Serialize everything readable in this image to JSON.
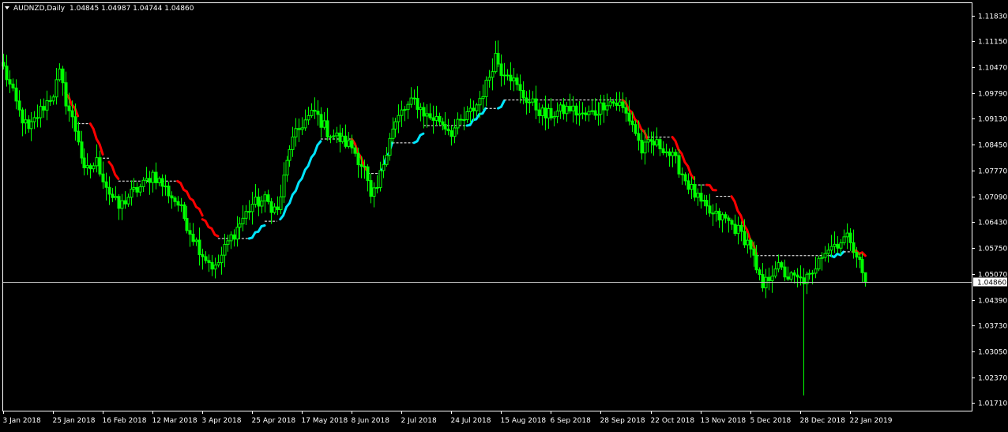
{
  "header": {
    "symbol_timeframe": "AUDNZD,Daily",
    "ohlc": "1.04845 1.04987 1.04744 1.04860"
  },
  "colors": {
    "background": "#000000",
    "frame": "#ffffff",
    "candle": "#00ff00",
    "trail_down": "#ff0000",
    "trail_up": "#00e5ff",
    "stop_line": "#ffffff",
    "current_price_line": "#c0c0c0"
  },
  "icons": {
    "menu": "triangle-down-icon"
  },
  "chart_data": {
    "type": "candlestick",
    "symbol": "AUDNZD",
    "timeframe": "Daily",
    "last_ohlc": {
      "open": 1.04845,
      "high": 1.04987,
      "low": 1.04744,
      "close": 1.0486
    },
    "current_price": 1.0486,
    "current_price_label": "1.04860",
    "ylim": [
      1.015,
      1.1215
    ],
    "y_ticks": [
      "1.11830",
      "1.11150",
      "1.10470",
      "1.09790",
      "1.09130",
      "1.08450",
      "1.07770",
      "1.07090",
      "1.06430",
      "1.05750",
      "1.05070",
      "1.04390",
      "1.03730",
      "1.03050",
      "1.02370",
      "1.01710"
    ],
    "y_tick_values": [
      1.1183,
      1.1115,
      1.1047,
      1.0979,
      1.0913,
      1.0845,
      1.0777,
      1.0709,
      1.0643,
      1.0575,
      1.0507,
      1.0439,
      1.0373,
      1.0305,
      1.0237,
      1.0171
    ],
    "x_ticks": [
      "3 Jan 2018",
      "25 Jan 2018",
      "16 Feb 2018",
      "12 Mar 2018",
      "3 Apr 2018",
      "25 Apr 2018",
      "17 May 2018",
      "8 Jun 2018",
      "2 Jul 2018",
      "24 Jul 2018",
      "15 Aug 2018",
      "6 Sep 2018",
      "28 Sep 2018",
      "22 Oct 2018",
      "13 Nov 2018",
      "5 Dec 2018",
      "28 Dec 2018",
      "22 Jan 2019"
    ],
    "x_tick_bar_index": [
      0,
      16,
      32,
      48,
      64,
      80,
      96,
      112,
      128,
      144,
      160,
      176,
      192,
      208,
      224,
      240,
      256,
      272
    ],
    "total_bars": 278,
    "anchors": [
      [
        0,
        1.1045
      ],
      [
        5,
        1.093
      ],
      [
        8,
        1.088
      ],
      [
        12,
        1.0935
      ],
      [
        16,
        1.098
      ],
      [
        18,
        1.103
      ],
      [
        20,
        1.096
      ],
      [
        24,
        1.086
      ],
      [
        26,
        1.077
      ],
      [
        30,
        1.08
      ],
      [
        34,
        1.072
      ],
      [
        37,
        1.068
      ],
      [
        40,
        1.071
      ],
      [
        45,
        1.074
      ],
      [
        48,
        1.077
      ],
      [
        52,
        1.073
      ],
      [
        56,
        1.069
      ],
      [
        60,
        1.062
      ],
      [
        64,
        1.056
      ],
      [
        68,
        1.052
      ],
      [
        72,
        1.059
      ],
      [
        76,
        1.064
      ],
      [
        80,
        1.069
      ],
      [
        84,
        1.07
      ],
      [
        88,
        1.067
      ],
      [
        92,
        1.084
      ],
      [
        96,
        1.09
      ],
      [
        100,
        1.093
      ],
      [
        104,
        1.088
      ],
      [
        108,
        1.086
      ],
      [
        112,
        1.084
      ],
      [
        116,
        1.078
      ],
      [
        118,
        1.07
      ],
      [
        120,
        1.073
      ],
      [
        124,
        1.087
      ],
      [
        128,
        1.093
      ],
      [
        132,
        1.096
      ],
      [
        136,
        1.092
      ],
      [
        140,
        1.091
      ],
      [
        144,
        1.088
      ],
      [
        148,
        1.091
      ],
      [
        152,
        1.095
      ],
      [
        155,
        1.1
      ],
      [
        158,
        1.108
      ],
      [
        160,
        1.104
      ],
      [
        162,
        1.104
      ],
      [
        166,
        1.098
      ],
      [
        170,
        1.095
      ],
      [
        174,
        1.092
      ],
      [
        178,
        1.093
      ],
      [
        182,
        1.094
      ],
      [
        186,
        1.092
      ],
      [
        190,
        1.093
      ],
      [
        194,
        1.096
      ],
      [
        198,
        1.095
      ],
      [
        202,
        1.09
      ],
      [
        205,
        1.083
      ],
      [
        208,
        1.085
      ],
      [
        212,
        1.084
      ],
      [
        216,
        1.08
      ],
      [
        220,
        1.074
      ],
      [
        224,
        1.069
      ],
      [
        228,
        1.066
      ],
      [
        232,
        1.065
      ],
      [
        236,
        1.062
      ],
      [
        240,
        1.058
      ],
      [
        242,
        1.051
      ],
      [
        244,
        1.047
      ],
      [
        248,
        1.053
      ],
      [
        252,
        1.05
      ],
      [
        256,
        1.049
      ],
      [
        260,
        1.05
      ],
      [
        262,
        1.056
      ],
      [
        266,
        1.058
      ],
      [
        270,
        1.06
      ],
      [
        272,
        1.06
      ],
      [
        274,
        1.056
      ],
      [
        277,
        1.0486
      ]
    ],
    "spike": {
      "bar": 257,
      "low": 1.019
    },
    "trailing_stop": [
      {
        "trend": "down",
        "from": 20,
        "to": 24,
        "start": 1.098,
        "end": 1.092
      },
      {
        "trend": "flat",
        "from": 24,
        "to": 28,
        "level": 1.09
      },
      {
        "trend": "down",
        "from": 28,
        "to": 32,
        "start": 1.09,
        "end": 1.082
      },
      {
        "trend": "flat",
        "from": 32,
        "to": 34,
        "level": 1.081
      },
      {
        "trend": "down",
        "from": 34,
        "to": 37,
        "start": 1.08,
        "end": 1.075
      },
      {
        "trend": "flat",
        "from": 37,
        "to": 56,
        "level": 1.075
      },
      {
        "trend": "down",
        "from": 56,
        "to": 64,
        "start": 1.075,
        "end": 1.066
      },
      {
        "trend": "down",
        "from": 64,
        "to": 69,
        "start": 1.065,
        "end": 1.06
      },
      {
        "trend": "flat",
        "from": 69,
        "to": 79,
        "level": 1.06
      },
      {
        "trend": "up",
        "from": 79,
        "to": 84,
        "start": 1.06,
        "end": 1.064
      },
      {
        "trend": "flat",
        "from": 84,
        "to": 88,
        "level": 1.0645
      },
      {
        "trend": "up",
        "from": 89,
        "to": 102,
        "start": 1.065,
        "end": 1.086
      },
      {
        "trend": "flat",
        "from": 102,
        "to": 112,
        "level": 1.086
      },
      {
        "trend": "down",
        "from": 112,
        "to": 117,
        "start": 1.086,
        "end": 1.077
      },
      {
        "trend": "flat",
        "from": 117,
        "to": 121,
        "level": 1.077
      },
      {
        "trend": "up",
        "from": 121,
        "to": 125,
        "start": 1.077,
        "end": 1.085
      },
      {
        "trend": "flat",
        "from": 125,
        "to": 132,
        "level": 1.085
      },
      {
        "trend": "up",
        "from": 132,
        "to": 135,
        "start": 1.085,
        "end": 1.088
      },
      {
        "trend": "flat",
        "from": 135,
        "to": 149,
        "level": 1.0895
      },
      {
        "trend": "up",
        "from": 149,
        "to": 155,
        "start": 1.0895,
        "end": 1.094
      },
      {
        "trend": "flat",
        "from": 155,
        "to": 159,
        "level": 1.094
      },
      {
        "trend": "up",
        "from": 159,
        "to": 161,
        "start": 1.094,
        "end": 1.096
      },
      {
        "trend": "flat",
        "from": 161,
        "to": 199,
        "level": 1.0962
      },
      {
        "trend": "down",
        "from": 199,
        "to": 207,
        "start": 1.0962,
        "end": 1.086
      },
      {
        "trend": "flat",
        "from": 207,
        "to": 215,
        "level": 1.0865
      },
      {
        "trend": "down",
        "from": 215,
        "to": 222,
        "start": 1.0865,
        "end": 1.075
      },
      {
        "trend": "flat",
        "from": 222,
        "to": 226,
        "level": 1.074
      },
      {
        "trend": "down",
        "from": 226,
        "to": 229,
        "start": 1.074,
        "end": 1.072
      },
      {
        "trend": "flat",
        "from": 229,
        "to": 234,
        "level": 1.071
      },
      {
        "trend": "down",
        "from": 234,
        "to": 242,
        "start": 1.071,
        "end": 1.056
      },
      {
        "trend": "flat",
        "from": 242,
        "to": 266,
        "level": 1.0555
      },
      {
        "trend": "up",
        "from": 266,
        "to": 270,
        "start": 1.0555,
        "end": 1.0565
      },
      {
        "trend": "flat",
        "from": 270,
        "to": 273,
        "level": 1.0565
      },
      {
        "trend": "down",
        "from": 273,
        "to": 277,
        "start": 1.0565,
        "end": 1.0555
      }
    ]
  }
}
